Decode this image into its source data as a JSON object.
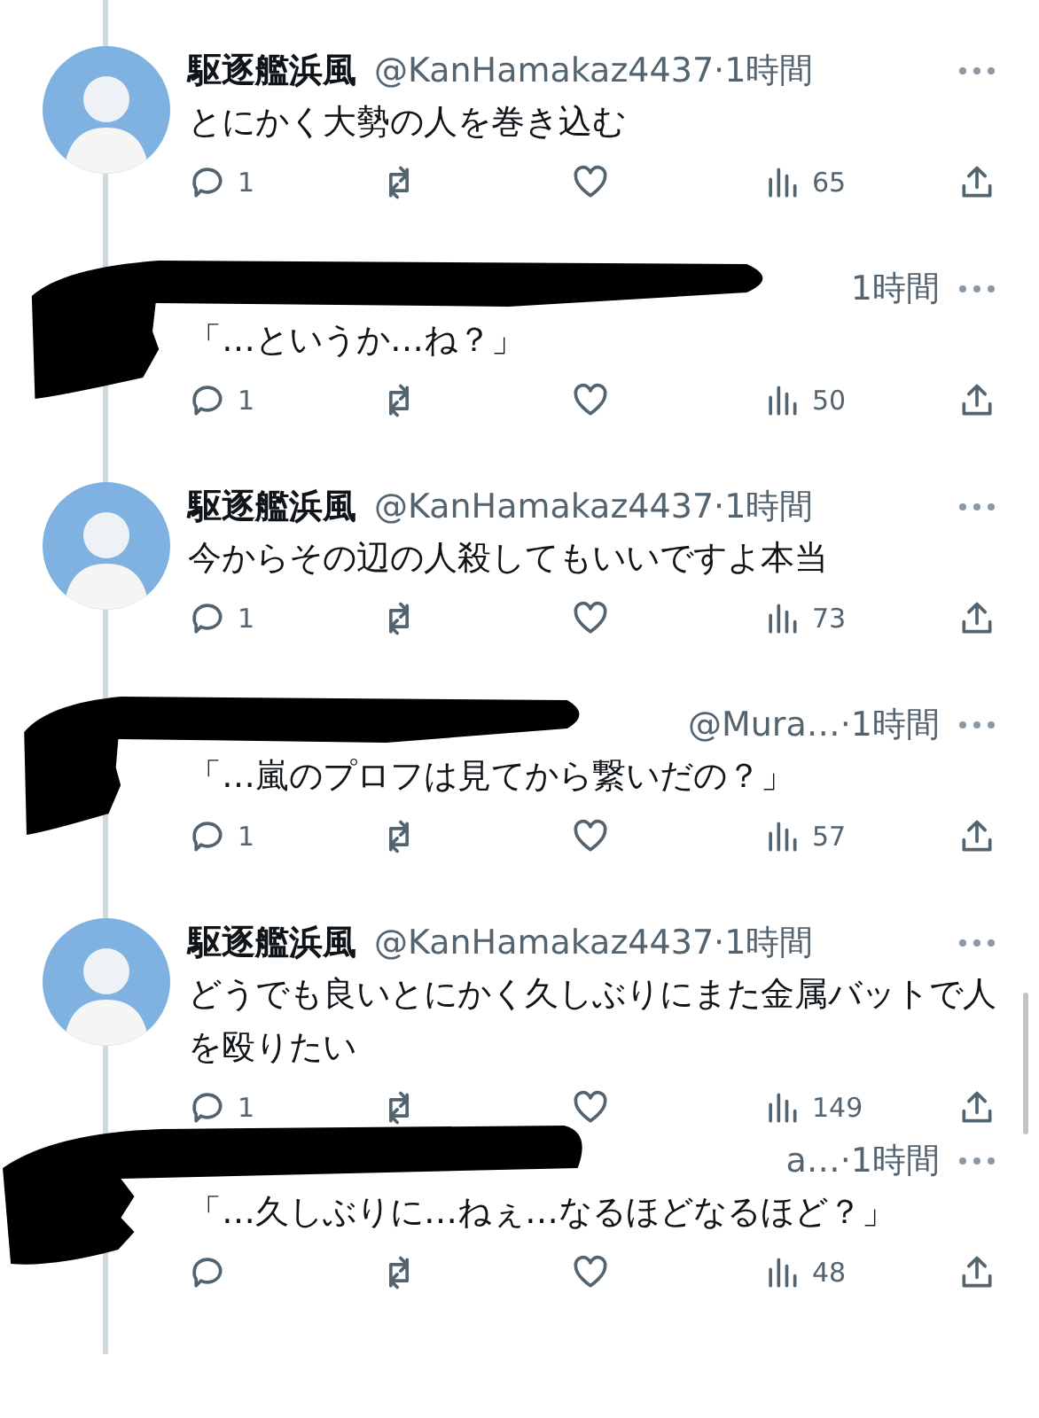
{
  "tweets": [
    {
      "kind": "author",
      "name": "駆逐艦浜風",
      "handle": "@KanHamakaz4437",
      "time": "·1時間",
      "text": "とにかく大勢の人を巻き込む",
      "replies": "1",
      "views": "65"
    },
    {
      "kind": "redacted",
      "meta": "1時間",
      "text": "「…というか…ね？」",
      "replies": "1",
      "views": "50"
    },
    {
      "kind": "author",
      "name": "駆逐艦浜風",
      "handle": "@KanHamakaz4437",
      "time": "·1時間",
      "text": "今からその辺の人殺してもいいですよ本当",
      "replies": "1",
      "views": "73"
    },
    {
      "kind": "redacted",
      "meta": "@Mura…·1時間",
      "text": "「…嵐のプロフは見てから繋いだの？」",
      "replies": "1",
      "views": "57"
    },
    {
      "kind": "author",
      "name": "駆逐艦浜風",
      "handle": "@KanHamakaz4437",
      "time": "·1時間",
      "text": "どうでも良いとにかく久しぶりにまた金属バットで人を殴りたい",
      "replies": "1",
      "views": "149"
    },
    {
      "kind": "redacted",
      "meta": "a…·1時間",
      "text": "「…久しぶりに…ねぇ…なるほどなるほど？」",
      "views": "48"
    }
  ]
}
